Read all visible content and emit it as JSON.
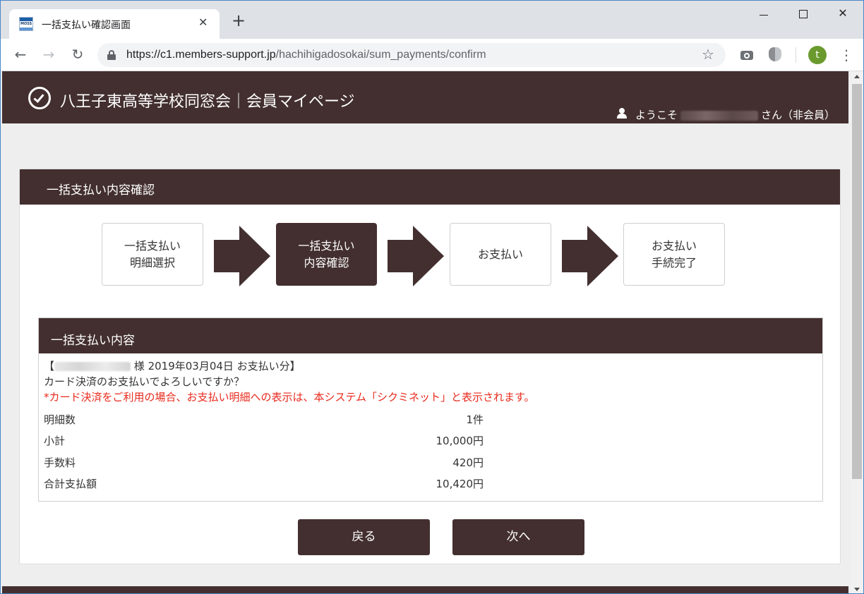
{
  "browser": {
    "tab_title": "一括支払い確認画面",
    "favicon_text": "MOSS",
    "tab_close": "✕",
    "new_tab": "+",
    "url_host": "https://c1.members-support.jp",
    "url_path": "/hachihigadosokai/sum_payments/confirm",
    "avatar_letter": "t"
  },
  "site": {
    "title": "八王子東高等学校同窓会｜会員マイページ",
    "welcome_prefix": "ようこそ",
    "welcome_suffix": "さん（非会員）"
  },
  "panel": {
    "title": "一括支払い内容確認"
  },
  "steps": [
    {
      "line1": "一括支払い",
      "line2": "明細選択",
      "active": false
    },
    {
      "line1": "一括支払い",
      "line2": "内容確認",
      "active": true
    },
    {
      "line1": "お支払い",
      "line2": "",
      "active": false
    },
    {
      "line1": "お支払い",
      "line2": "手続完了",
      "active": false
    }
  ],
  "detail": {
    "title": "一括支払い内容",
    "header_open": "【",
    "header_rest": "様 2019年03月04日 お支払い分】",
    "question": "カード決済のお支払いでよろしいですか？",
    "notice": "*カード決済をご利用の場合、お支払い明細への表示は、本システム「シクミネット」と表示されます。",
    "rows": [
      {
        "label": "明細数",
        "value": "1件"
      },
      {
        "label": "小計",
        "value": "10,000円"
      },
      {
        "label": "手数料",
        "value": "420円"
      },
      {
        "label": "合計支払額",
        "value": "10,420円"
      }
    ]
  },
  "buttons": {
    "back": "戻る",
    "next": "次へ"
  },
  "colors": {
    "brand": "#432f2f",
    "notice": "#e8291c"
  }
}
